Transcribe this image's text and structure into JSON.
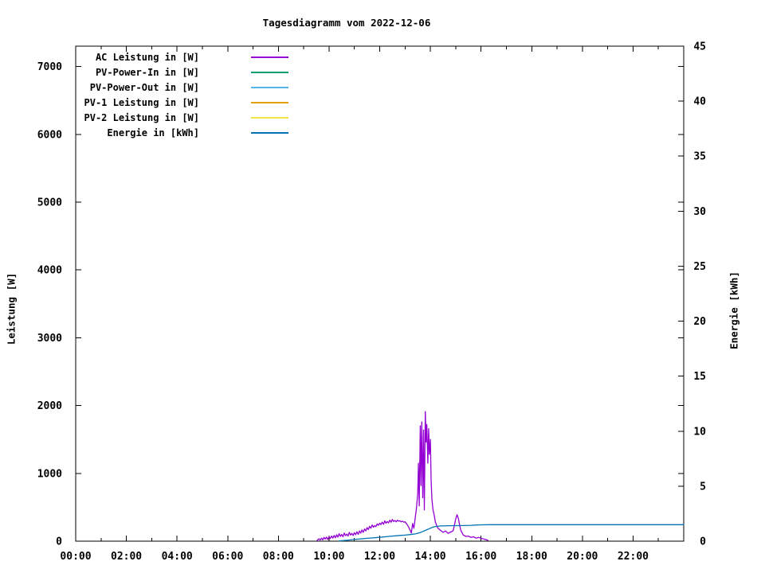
{
  "page": {
    "background": "#ffffff"
  },
  "chart_data": {
    "type": "line",
    "title": "Tagesdiagramm vom 2022-12-06",
    "xlabel": "",
    "ylabel_left": "Leistung [W]",
    "ylabel_right": "Energie [kWh]",
    "grid": false,
    "legend_position": "top-left-inside",
    "x_axis": {
      "unit": "time-of-day",
      "range_hours": [
        0,
        24
      ],
      "major_tick_hours": 2,
      "minor_tick_hours": 1,
      "tick_labels": [
        "00:00",
        "02:00",
        "04:00",
        "06:00",
        "08:00",
        "10:00",
        "12:00",
        "14:00",
        "16:00",
        "18:00",
        "20:00",
        "22:00"
      ]
    },
    "y_axis_left": {
      "label": "Leistung [W]",
      "range": [
        0,
        7300
      ],
      "tick_interval": 1000,
      "tick_labels": [
        "0",
        "1000",
        "2000",
        "3000",
        "4000",
        "5000",
        "6000",
        "7000"
      ]
    },
    "y_axis_right": {
      "label": "Energie [kWh]",
      "range": [
        0,
        45
      ],
      "tick_interval": 5,
      "tick_labels": [
        "0",
        "5",
        "10",
        "15",
        "20",
        "25",
        "30",
        "35",
        "40",
        "45"
      ]
    },
    "legend": [
      {
        "label": "AC Leistung in [W]",
        "color": "#9400D3"
      },
      {
        "label": "PV-Power-In in [W]",
        "color": "#009E73"
      },
      {
        "label": "PV-Power-Out in [W]",
        "color": "#56B4E9"
      },
      {
        "label": "PV-1 Leistung in [W]",
        "color": "#E69F00"
      },
      {
        "label": "PV-2 Leistung in [W]",
        "color": "#F0E442"
      },
      {
        "label": "Energie in [kWh]",
        "color": "#0072B2"
      }
    ],
    "series": [
      {
        "name": "AC Leistung in [W]",
        "slug": "ac-leistung",
        "color": "#9400D3",
        "axis": "left",
        "y_unit": "W",
        "x": [
          9.53,
          9.6,
          9.65,
          9.7,
          9.75,
          9.8,
          9.85,
          9.9,
          9.95,
          10.0,
          10.05,
          10.1,
          10.15,
          10.2,
          10.25,
          10.3,
          10.35,
          10.4,
          10.45,
          10.5,
          10.55,
          10.6,
          10.65,
          10.7,
          10.75,
          10.8,
          10.85,
          10.9,
          10.95,
          11.0,
          11.05,
          11.1,
          11.15,
          11.2,
          11.25,
          11.3,
          11.35,
          11.4,
          11.45,
          11.5,
          11.55,
          11.6,
          11.65,
          11.7,
          11.75,
          11.8,
          11.85,
          11.9,
          11.95,
          12.0,
          12.05,
          12.1,
          12.15,
          12.2,
          12.25,
          12.3,
          12.35,
          12.4,
          12.45,
          12.5,
          12.55,
          12.6,
          12.65,
          12.7,
          12.75,
          12.8,
          12.85,
          12.9,
          12.95,
          13.0,
          13.05,
          13.1,
          13.15,
          13.2,
          13.25,
          13.3,
          13.35,
          13.4,
          13.45,
          13.5,
          13.53,
          13.56,
          13.6,
          13.63,
          13.66,
          13.7,
          13.73,
          13.76,
          13.8,
          13.83,
          13.86,
          13.9,
          13.93,
          13.96,
          14.0,
          14.03,
          14.06,
          14.1,
          14.15,
          14.2,
          14.25,
          14.3,
          14.4,
          14.5,
          14.6,
          14.7,
          14.8,
          14.9,
          14.95,
          15.0,
          15.05,
          15.1,
          15.15,
          15.2,
          15.3,
          15.4,
          15.5,
          15.6,
          15.7,
          15.8,
          15.9,
          16.0,
          16.1,
          16.2,
          16.27
        ],
        "y": [
          10,
          35,
          15,
          45,
          20,
          55,
          30,
          60,
          25,
          65,
          40,
          75,
          45,
          85,
          50,
          95,
          60,
          110,
          70,
          100,
          65,
          120,
          80,
          105,
          75,
          130,
          90,
          115,
          85,
          125,
          95,
          140,
          100,
          150,
          120,
          165,
          130,
          180,
          150,
          200,
          170,
          220,
          190,
          240,
          205,
          230,
          215,
          255,
          235,
          265,
          245,
          280,
          250,
          300,
          265,
          290,
          270,
          310,
          280,
          320,
          290,
          305,
          285,
          310,
          295,
          300,
          285,
          295,
          280,
          285,
          260,
          235,
          200,
          160,
          120,
          260,
          190,
          340,
          480,
          700,
          1150,
          520,
          1700,
          820,
          1760,
          640,
          1640,
          460,
          1910,
          1460,
          1720,
          1150,
          1660,
          1280,
          1500,
          900,
          620,
          470,
          380,
          280,
          230,
          190,
          160,
          130,
          150,
          115,
          135,
          155,
          240,
          330,
          390,
          340,
          250,
          160,
          90,
          70,
          75,
          55,
          65,
          45,
          55,
          42,
          32,
          22,
          12
        ]
      },
      {
        "name": "PV-Power-In in [W]",
        "slug": "pv-power-in",
        "color": "#009E73",
        "axis": "left",
        "y_unit": "W",
        "x": [],
        "y": []
      },
      {
        "name": "PV-Power-Out in [W]",
        "slug": "pv-power-out",
        "color": "#56B4E9",
        "axis": "left",
        "y_unit": "W",
        "x": [],
        "y": []
      },
      {
        "name": "PV-1 Leistung in [W]",
        "slug": "pv1-leistung",
        "color": "#E69F00",
        "axis": "left",
        "y_unit": "W",
        "x": [],
        "y": []
      },
      {
        "name": "PV-2 Leistung in [W]",
        "slug": "pv2-leistung",
        "color": "#F0E442",
        "axis": "left",
        "y_unit": "W",
        "x": [],
        "y": []
      },
      {
        "name": "Energie in [kWh]",
        "slug": "energie",
        "color": "#0072B2",
        "axis": "right",
        "y_unit": "kWh",
        "x": [
          10.4,
          10.7,
          11.0,
          11.3,
          11.6,
          12.0,
          12.4,
          12.8,
          13.0,
          13.2,
          13.4,
          13.6,
          13.8,
          14.0,
          14.1,
          14.2,
          14.4,
          14.7,
          15.0,
          15.3,
          15.6,
          15.8,
          16.0,
          16.3,
          17.0,
          18.0,
          20.0,
          22.0,
          24.0
        ],
        "y": [
          0.02,
          0.08,
          0.15,
          0.22,
          0.28,
          0.35,
          0.44,
          0.52,
          0.55,
          0.6,
          0.66,
          0.78,
          0.98,
          1.18,
          1.27,
          1.33,
          1.38,
          1.4,
          1.41,
          1.42,
          1.44,
          1.47,
          1.48,
          1.5,
          1.5,
          1.5,
          1.5,
          1.5,
          1.5
        ]
      }
    ]
  }
}
